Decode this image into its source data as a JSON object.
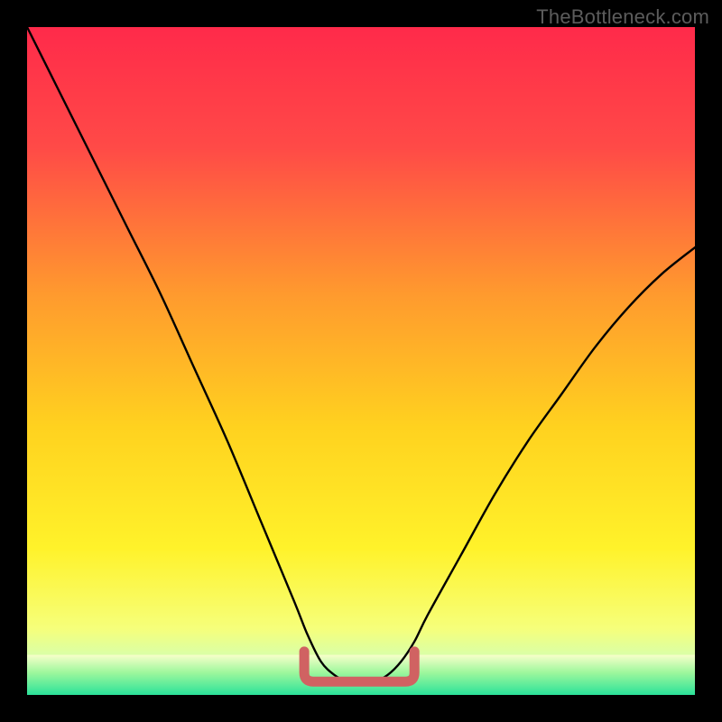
{
  "watermark": "TheBottleneck.com",
  "chart_data": {
    "type": "line",
    "title": "",
    "xlabel": "",
    "ylabel": "",
    "xlim": [
      0,
      100
    ],
    "ylim": [
      0,
      100
    ],
    "grid": false,
    "legend": false,
    "curve_main": {
      "x": [
        0,
        5,
        10,
        15,
        20,
        25,
        30,
        35,
        40,
        42,
        44,
        46,
        48,
        50,
        52,
        54,
        56,
        58,
        60,
        65,
        70,
        75,
        80,
        85,
        90,
        95,
        100
      ],
      "y": [
        100,
        90,
        80,
        70,
        60,
        49,
        38,
        26,
        14,
        9,
        5,
        3,
        2,
        2,
        2,
        3,
        5,
        8,
        12,
        21,
        30,
        38,
        45,
        52,
        58,
        63,
        67
      ]
    },
    "optimal_band": {
      "start_x": 41.5,
      "end_x": 58,
      "y": 2,
      "height": 4.5,
      "color": "#d06262"
    },
    "baseline_band": {
      "y_top": 6,
      "y_bottom": 0,
      "color_top": "#f8ffc9",
      "color_mid": "#9cf79c",
      "color_bottom": "#2be29a"
    },
    "background_gradient": {
      "type": "red-yellow-green",
      "stops": [
        {
          "offset": 0.0,
          "color": "#ff2a4a"
        },
        {
          "offset": 0.18,
          "color": "#ff4a47"
        },
        {
          "offset": 0.4,
          "color": "#ff9a2e"
        },
        {
          "offset": 0.6,
          "color": "#ffd21f"
        },
        {
          "offset": 0.78,
          "color": "#fff22a"
        },
        {
          "offset": 0.9,
          "color": "#f6ff7a"
        },
        {
          "offset": 0.95,
          "color": "#d3ffb1"
        },
        {
          "offset": 1.0,
          "color": "#26e49a"
        }
      ]
    }
  }
}
